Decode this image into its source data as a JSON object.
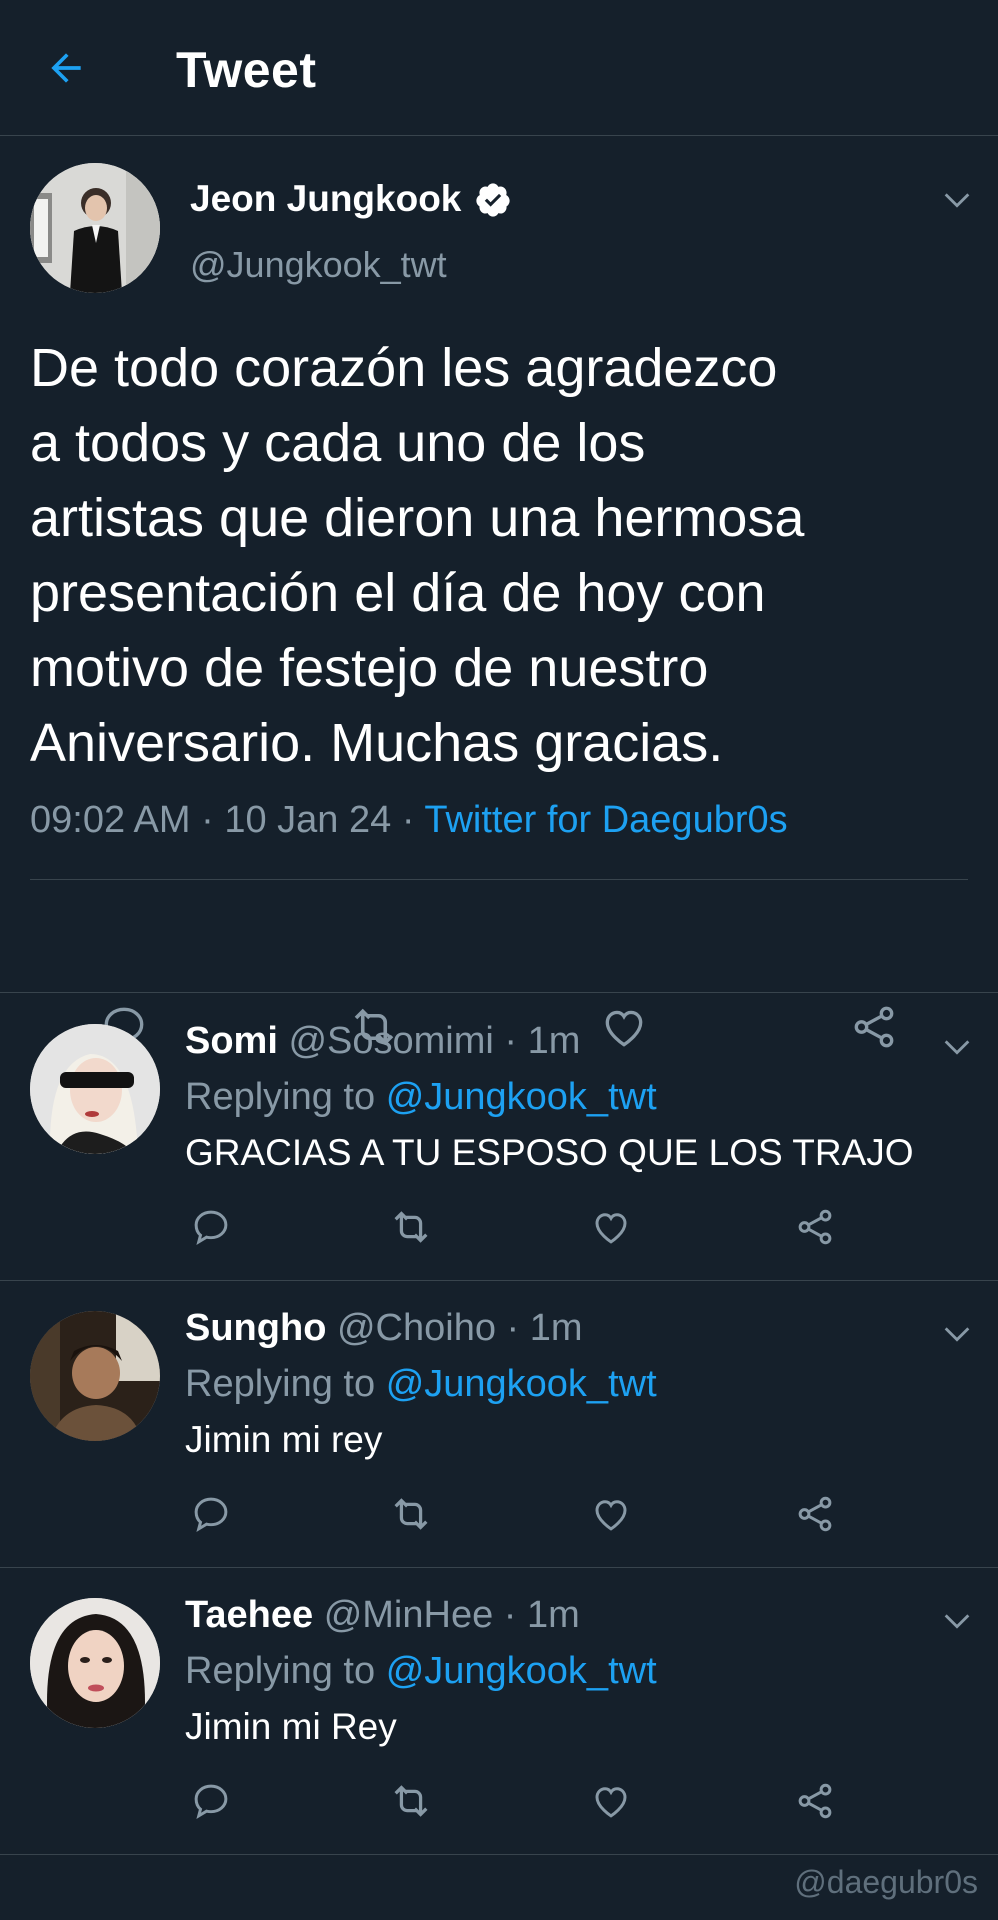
{
  "colors": {
    "background": "#15202b",
    "divider": "#38444d",
    "accent": "#1da1f2",
    "muted": "#8899a6",
    "text": "#ffffff"
  },
  "header": {
    "back_icon": "arrow-left-icon",
    "title": "Tweet"
  },
  "tweet": {
    "author_name": "Jeon Jungkook",
    "verified_icon": "verified-badge-icon",
    "author_handle": "@Jungkook_twt",
    "text": "De todo corazón les agradezco\na todos y cada uno de los\nartistas que dieron una hermosa\npresentación el día de hoy con\nmotivo de festejo de nuestro\nAniversario.  Muchas gracias.",
    "time": "09:02 AM",
    "date": "10 Jan 24",
    "separator": " · ",
    "source": "Twitter for Daegubr0s",
    "actions": [
      "reply-icon",
      "retweet-icon",
      "like-icon",
      "share-icon"
    ]
  },
  "replies": [
    {
      "name": "Somi",
      "handle": "@Sosomimi",
      "time": "1m",
      "replying_label": "Replying to",
      "replying_handle": "@Jungkook_twt",
      "text": "GRACIAS A TU ESPOSO QUE LOS TRAJO"
    },
    {
      "name": "Sungho",
      "handle": "@Choiho",
      "time": "1m",
      "replying_label": "Replying to",
      "replying_handle": "@Jungkook_twt",
      "text": "Jimin mi rey"
    },
    {
      "name": "Taehee",
      "handle": "@MinHee",
      "time": "1m",
      "replying_label": "Replying to",
      "replying_handle": "@Jungkook_twt",
      "text": "Jimin mi Rey"
    }
  ],
  "watermark": "@daegubr0s"
}
